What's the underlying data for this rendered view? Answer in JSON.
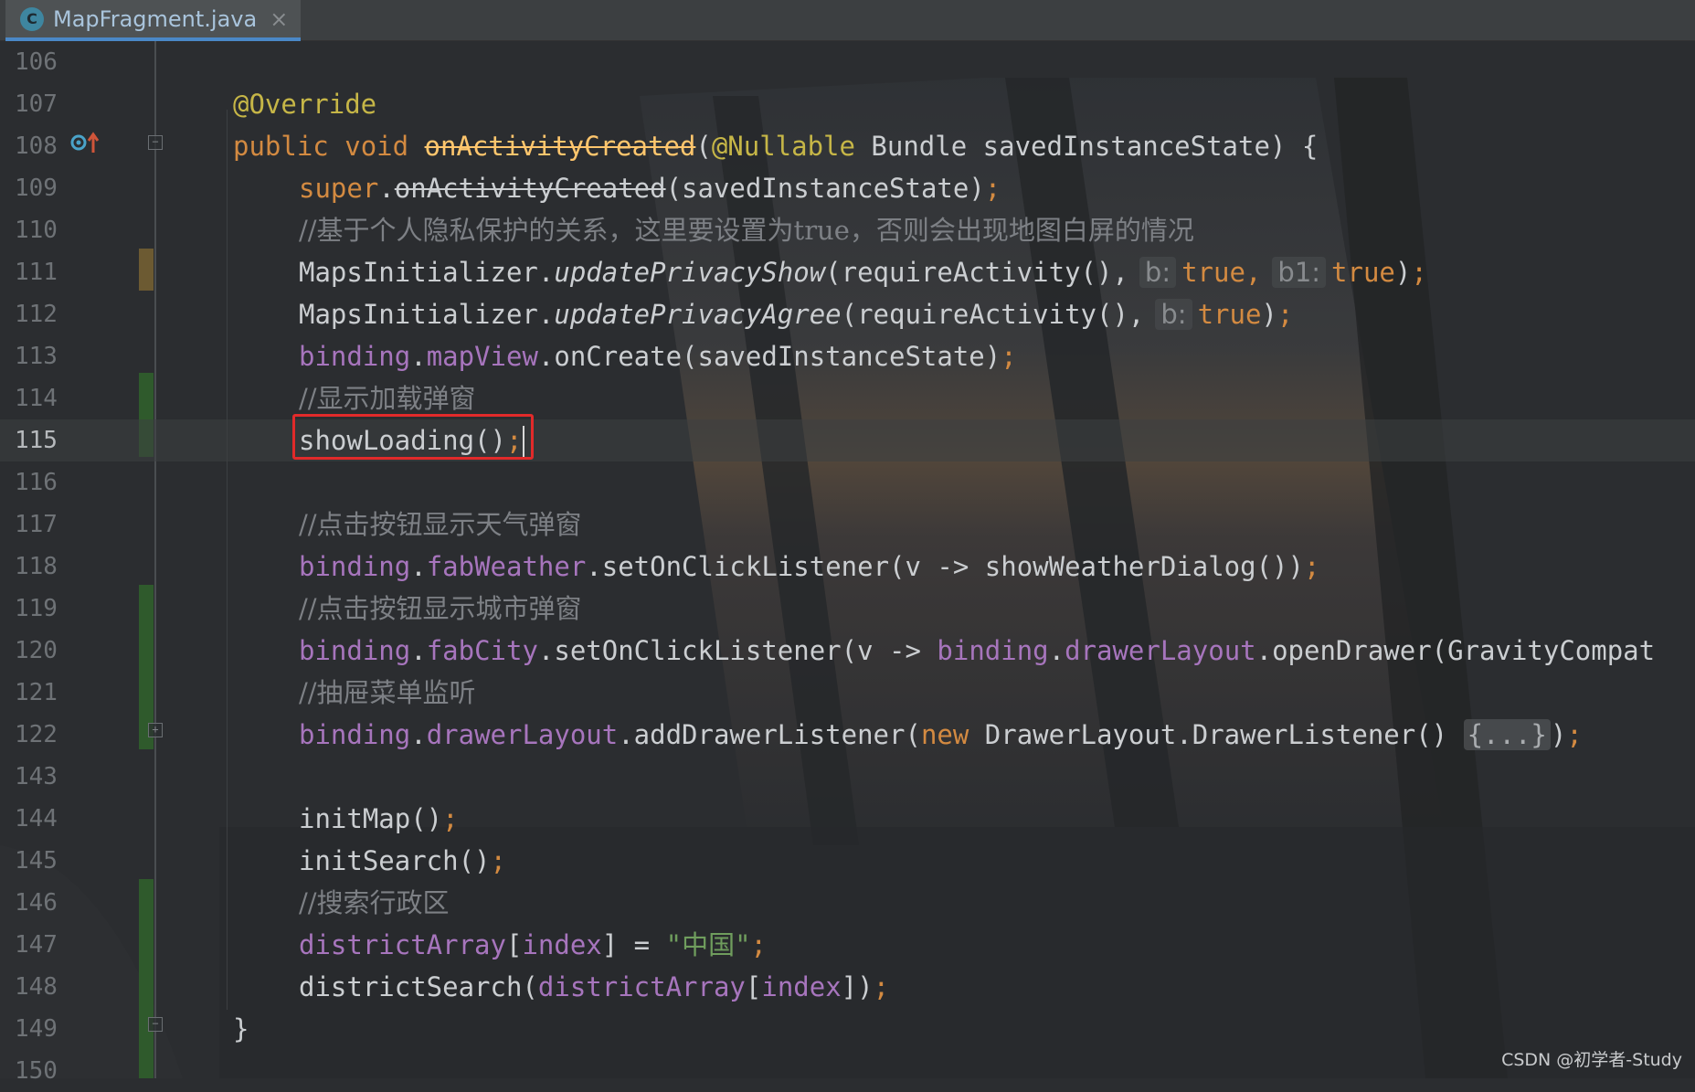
{
  "tab": {
    "icon_letter": "C",
    "file_name": "MapFragment.java",
    "close_glyph": "×"
  },
  "colors": {
    "keyword": "#d38a41",
    "annotation": "#c6b647",
    "field": "#a775bd",
    "method_decl": "#ffc66d",
    "comment": "#7d8085",
    "string": "#6f9d5d",
    "highlight_box": "#e12a2a",
    "added_change": "#2f5a2c",
    "modified_change": "#6c5a32"
  },
  "editor": {
    "current_line": "115",
    "lines": {
      "l106": {
        "num": "106"
      },
      "l107": {
        "num": "107",
        "annotation": "@Override"
      },
      "l108": {
        "num": "108",
        "kw_public": "public",
        "kw_void": "void",
        "method": "onActivityCreated",
        "open": "(",
        "param_ann": "@Nullable",
        "rest": " Bundle savedInstanceState) {"
      },
      "l109": {
        "num": "109",
        "kw_super": "super",
        "dot": ".",
        "method": "onActivityCreated",
        "rest": "(savedInstanceState)",
        "semi": ";"
      },
      "l110": {
        "num": "110",
        "comment": "//基于个人隐私保护的关系，这里要设置为true，否则会出现地图白屏的情况"
      },
      "l111": {
        "num": "111",
        "prefix": "MapsInitializer.",
        "method": "updatePrivacyShow",
        "args": "(requireActivity(),",
        "hint_b": "b:",
        "val1": "true",
        "comma": ",",
        "hint_b1": "b1:",
        "val2": "true",
        "close": ")",
        "semi": ";"
      },
      "l112": {
        "num": "112",
        "prefix": "MapsInitializer.",
        "method": "updatePrivacyAgree",
        "args": "(requireActivity(),",
        "hint_b": "b:",
        "val1": "true",
        "close": ")",
        "semi": ";"
      },
      "l113": {
        "num": "113",
        "field_binding": "binding",
        "dot1": ".",
        "field_map": "mapView",
        "rest": ".onCreate(savedInstanceState)",
        "semi": ";"
      },
      "l114": {
        "num": "114",
        "comment": "//显示加载弹窗"
      },
      "l115": {
        "num": "115",
        "code": "showLoading()",
        "semi": ";"
      },
      "l116": {
        "num": "116"
      },
      "l117": {
        "num": "117",
        "comment": "//点击按钮显示天气弹窗"
      },
      "l118": {
        "num": "118",
        "field_binding": "binding",
        "dot1": ".",
        "field_fab": "fabWeather",
        "rest": ".setOnClickListener(v -> showWeatherDialog())",
        "semi": ";"
      },
      "l119": {
        "num": "119",
        "comment": "//点击按钮显示城市弹窗"
      },
      "l120": {
        "num": "120",
        "field_binding": "binding",
        "dot1": ".",
        "field_fab": "fabCity",
        "mid": ".setOnClickListener(v -> ",
        "field_binding2": "binding",
        "dot2": ".",
        "field_drawer": "drawerLayout",
        "rest": ".openDrawer(GravityCompat"
      },
      "l121": {
        "num": "121",
        "comment": "//抽屉菜单监听"
      },
      "l122": {
        "num": "122",
        "field_binding": "binding",
        "dot1": ".",
        "field_drawer": "drawerLayout",
        "mid": ".addDrawerListener(",
        "kw_new": "new",
        "rest": " DrawerLayout.DrawerListener() ",
        "folded": "{...}",
        "close": ")",
        "semi": ";"
      },
      "l143": {
        "num": "143"
      },
      "l144": {
        "num": "144",
        "code": "initMap()",
        "semi": ";"
      },
      "l145": {
        "num": "145",
        "code": "initSearch()",
        "semi": ";"
      },
      "l146": {
        "num": "146",
        "comment": "//搜索行政区"
      },
      "l147": {
        "num": "147",
        "field": "districtArray",
        "open": "[",
        "field2": "index",
        "mid": "] = ",
        "string": "\"中国\"",
        "semi": ";"
      },
      "l148": {
        "num": "148",
        "prefix": "districtSearch(",
        "field": "districtArray",
        "open": "[",
        "field2": "index",
        "close": "])",
        "semi": ";"
      },
      "l149": {
        "num": "149",
        "brace": "}"
      },
      "l150": {
        "num": "150"
      }
    }
  },
  "watermark": "CSDN @初学者-Study"
}
